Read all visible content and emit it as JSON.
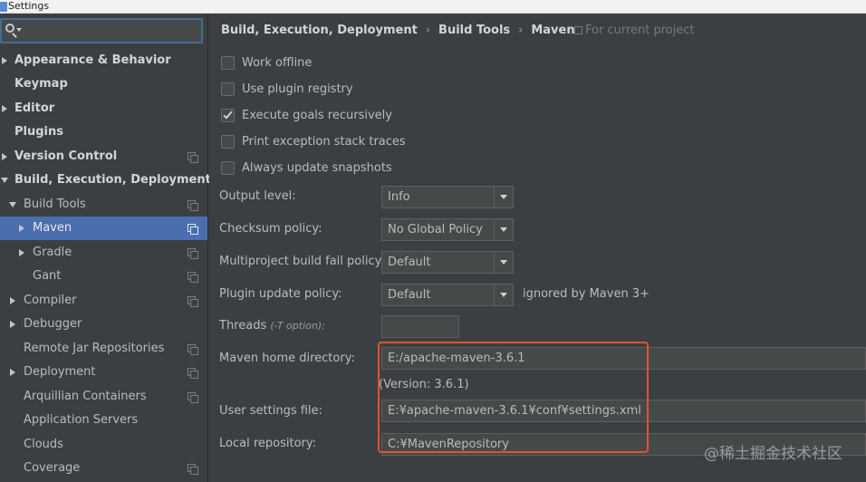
{
  "window": {
    "title": "Settings"
  },
  "sidebar": {
    "search": {
      "placeholder": ""
    },
    "items": [
      {
        "label": "Appearance & Behavior",
        "bold": true,
        "arrow": "right"
      },
      {
        "label": "Keymap",
        "bold": true,
        "arrow": ""
      },
      {
        "label": "Editor",
        "bold": true,
        "arrow": "right"
      },
      {
        "label": "Plugins",
        "bold": true,
        "arrow": ""
      },
      {
        "label": "Version Control",
        "bold": true,
        "arrow": "right",
        "icon": "project-scope-icon"
      },
      {
        "label": "Build, Execution, Deployment",
        "bold": true,
        "arrow": "down"
      },
      {
        "label": "Build Tools",
        "bold": false,
        "arrow": "down",
        "icon": "project-scope-icon"
      },
      {
        "label": "Maven",
        "bold": false,
        "arrow": "right",
        "icon": "project-scope-icon",
        "selected": true
      },
      {
        "label": "Gradle",
        "bold": false,
        "arrow": "right",
        "icon": "project-scope-icon"
      },
      {
        "label": "Gant",
        "bold": false,
        "arrow": "",
        "icon": "project-scope-icon"
      },
      {
        "label": "Compiler",
        "bold": false,
        "arrow": "right",
        "icon": "project-scope-icon"
      },
      {
        "label": "Debugger",
        "bold": false,
        "arrow": "right"
      },
      {
        "label": "Remote Jar Repositories",
        "bold": false,
        "arrow": "",
        "icon": "project-scope-icon"
      },
      {
        "label": "Deployment",
        "bold": false,
        "arrow": "right",
        "icon": "project-scope-icon"
      },
      {
        "label": "Arquillian Containers",
        "bold": false,
        "arrow": "",
        "icon": "project-scope-icon"
      },
      {
        "label": "Application Servers",
        "bold": false,
        "arrow": ""
      },
      {
        "label": "Clouds",
        "bold": false,
        "arrow": ""
      },
      {
        "label": "Coverage",
        "bold": false,
        "arrow": "",
        "icon": "project-scope-icon"
      }
    ]
  },
  "breadcrumb": {
    "items": [
      "Build, Execution, Deployment",
      "Build Tools",
      "Maven"
    ],
    "separator": "›",
    "scope_note": "For current project"
  },
  "maven": {
    "checkboxes": [
      {
        "label": "Work offline",
        "checked": false
      },
      {
        "label": "Use plugin registry",
        "checked": false
      },
      {
        "label": "Execute goals recursively",
        "checked": true
      },
      {
        "label": "Print exception stack traces",
        "checked": false
      },
      {
        "label": "Always update snapshots",
        "checked": false
      }
    ],
    "output_level": {
      "label": "Output level:",
      "value": "Info"
    },
    "checksum_policy": {
      "label": "Checksum policy:",
      "value": "No Global Policy"
    },
    "fail_policy": {
      "label": "Multiproject build fail policy:",
      "value": "Default"
    },
    "plugin_update_policy": {
      "label": "Plugin update policy:",
      "value": "Default",
      "hint": "ignored by Maven 3+"
    },
    "threads": {
      "label": "Threads",
      "option": "(-T option):",
      "value": ""
    },
    "home_directory": {
      "label": "Maven home directory:",
      "value": "E:/apache-maven-3.6.1",
      "version": "(Version: 3.6.1)"
    },
    "user_settings": {
      "label": "User settings file:",
      "value": "E:¥apache-maven-3.6.1¥conf¥settings.xml"
    },
    "local_repository": {
      "label": "Local repository:",
      "value": "C:¥MavenRepository"
    }
  },
  "watermark": "@稀土掘金技术社区",
  "colors": {
    "selection": "#4b6eaf",
    "annotation_box": "#e0532f",
    "panel": "#3c3f41"
  }
}
